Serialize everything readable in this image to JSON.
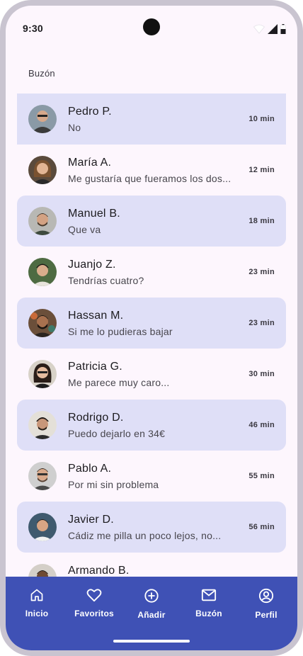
{
  "status": {
    "time": "9:30",
    "icons": [
      "wifi-icon",
      "signal-icon",
      "battery-icon"
    ]
  },
  "header": {
    "title": "Buzón"
  },
  "colors": {
    "highlight": "#dfdff7",
    "background": "#fdf6fd",
    "nav": "#3f51b5"
  },
  "messages": [
    {
      "name": "Pedro P.",
      "message": "No",
      "time": "10 min",
      "highlighted": true
    },
    {
      "name": "María A.",
      "message": "Me gustaría que fueramos los dos...",
      "time": "12 min",
      "highlighted": false
    },
    {
      "name": "Manuel B.",
      "message": "Que va",
      "time": "18 min",
      "highlighted": true
    },
    {
      "name": "Juanjo Z.",
      "message": "Tendrías cuatro?",
      "time": "23 min",
      "highlighted": false
    },
    {
      "name": "Hassan M.",
      "message": "Si me lo pudieras bajar",
      "time": "23 min",
      "highlighted": true
    },
    {
      "name": "Patricia G.",
      "message": "Me parece muy caro...",
      "time": "30 min",
      "highlighted": false
    },
    {
      "name": "Rodrigo D.",
      "message": "Puedo dejarlo en 34€",
      "time": "46 min",
      "highlighted": true
    },
    {
      "name": "Pablo A.",
      "message": "Por mi sin problema",
      "time": "55 min",
      "highlighted": false
    },
    {
      "name": "Javier D.",
      "message": "Cádiz me pilla un poco lejos, no...",
      "time": "56 min",
      "highlighted": true
    },
    {
      "name": "Armando B.",
      "message": "",
      "time": "",
      "highlighted": false
    }
  ],
  "nav": [
    {
      "label": "Inicio",
      "icon": "home-icon"
    },
    {
      "label": "Favoritos",
      "icon": "heart-icon"
    },
    {
      "label": "Añadir",
      "icon": "add-circle-icon"
    },
    {
      "label": "Buzón",
      "icon": "mail-icon"
    },
    {
      "label": "Perfil",
      "icon": "account-circle-icon"
    }
  ]
}
